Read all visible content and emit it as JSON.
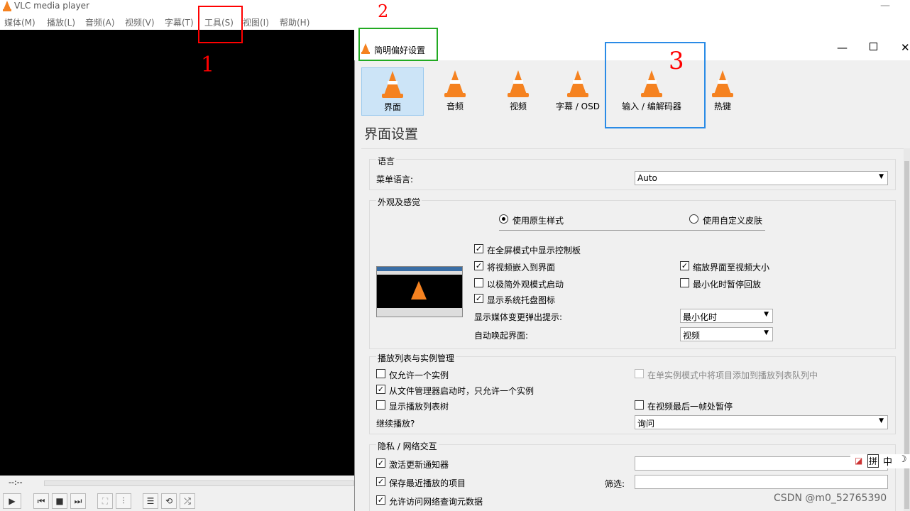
{
  "main_window": {
    "title": "VLC media player",
    "menu": [
      "媒体(M)",
      "播放(L)",
      "音频(A)",
      "视频(V)",
      "字幕(T)",
      "工具(S)",
      "视图(I)",
      "帮助(H)"
    ],
    "time": "--:--",
    "controls": [
      "play-icon",
      "prev-icon",
      "stop-icon",
      "next-icon",
      "fullscreen-icon",
      "extended-settings-icon",
      "playlist-icon",
      "loop-icon",
      "shuffle-icon"
    ]
  },
  "prefs": {
    "title": "简明偏好设置",
    "categories": [
      "界面",
      "音频",
      "视频",
      "字幕 / OSD",
      "输入 / 编解码器",
      "热键"
    ],
    "section_title": "界面设置",
    "language": {
      "group": "语言",
      "menu_lang_label": "菜单语言:",
      "menu_lang_value": "Auto"
    },
    "look": {
      "group": "外观及感觉",
      "native_style": "使用原生样式",
      "custom_skin": "使用自定义皮肤",
      "opt_fs_controller": "在全屏模式中显示控制板",
      "opt_embed_video": "将视频嵌入到界面",
      "opt_minimal": "以极简外观模式启动",
      "opt_systray": "显示系统托盘图标",
      "opt_resize": "缩放界面至视频大小",
      "opt_pause_min": "最小化时暂停回放",
      "popup_label": "显示媒体变更弹出提示:",
      "popup_value": "最小化时",
      "raise_label": "自动唤起界面:",
      "raise_value": "视频"
    },
    "playlist": {
      "group": "播放列表与实例管理",
      "one_instance": "仅允许一个实例",
      "enqueue": "在单实例模式中将项目添加到播放列表队列中",
      "one_instance_fm": "从文件管理器启动时，只允许一个实例",
      "tree": "显示播放列表树",
      "pause_last": "在视频最后一帧处暂停",
      "resume_label": "继续播放?",
      "resume_value": "询问"
    },
    "privacy": {
      "group": "隐私 / 网络交互",
      "update": "激活更新通知器",
      "recent": "保存最近播放的项目",
      "filter_label": "筛选:",
      "metadata": "允许访问网络查询元数据"
    }
  },
  "ime": {
    "text": "中"
  },
  "watermark": "CSDN @m0_52765390",
  "annotations": [
    "1",
    "2",
    "3"
  ]
}
